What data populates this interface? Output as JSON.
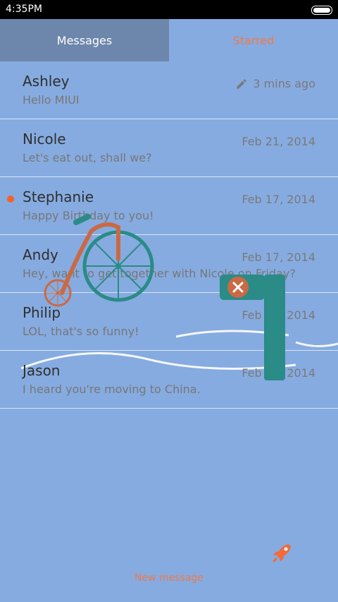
{
  "status": {
    "time": "4:35PM"
  },
  "tabs": {
    "messages": "Messages",
    "starred": "Starred"
  },
  "messages": [
    {
      "name": "Ashley",
      "preview": "Hello MIUI",
      "date": "3 mins ago"
    },
    {
      "name": "Nicole",
      "preview": "Let's eat out, shall we?",
      "date": "Feb 21, 2014"
    },
    {
      "name": "Stephanie",
      "preview": "Happy Birthday to you!",
      "date": "Feb 17, 2014"
    },
    {
      "name": "Andy",
      "preview": "Hey, want to get together with Nicole on Friday?",
      "date": "Feb 17, 2014"
    },
    {
      "name": "Philip",
      "preview": "LOL, that's so funny!",
      "date": "Feb 17, 2014"
    },
    {
      "name": "Jason",
      "preview": "I heard you're moving to China.",
      "date": "Feb 17, 2014"
    }
  ],
  "footer": {
    "new_message": "New message"
  },
  "colors": {
    "accent": "#ef7a48",
    "teal": "#2a8b87",
    "bg": "#86abe0"
  }
}
